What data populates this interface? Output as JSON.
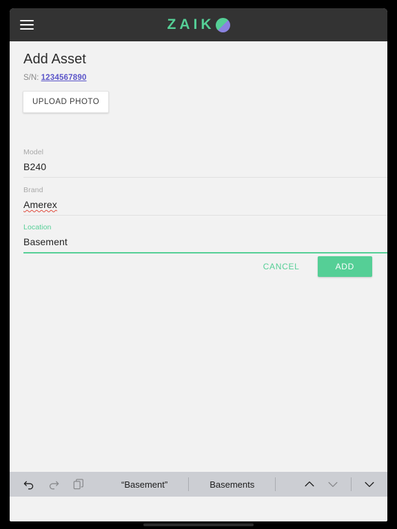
{
  "appbar": {
    "menu_icon": "hamburger-menu-icon",
    "logo_text": "ZAIK",
    "logo_mark": "half-circle-logo-mark",
    "background_color": "#333333"
  },
  "page": {
    "title": "Add Asset",
    "serial_label": "S/N:",
    "serial_number": "1234567890",
    "upload_photo_label": "UPLOAD PHOTO",
    "background_color": "#f2f2f2"
  },
  "form": {
    "fields": [
      {
        "label": "Model",
        "value": "B240",
        "focused": false,
        "misspelled": false
      },
      {
        "label": "Brand",
        "value": "Amerex",
        "focused": false,
        "misspelled": true
      },
      {
        "label": "Location",
        "value": "Basement",
        "focused": true,
        "misspelled": false
      }
    ],
    "cancel_label": "CANCEL",
    "add_label": "ADD",
    "accent_color": "#55cf96",
    "link_color": "#5b55c9"
  },
  "toolbar": {
    "undo_icon": "undo-arrow-icon",
    "redo_icon": "redo-arrow-icon",
    "paste_icon": "paste-clipboard-icon",
    "suggestions": [
      "“Basement”",
      "Basements"
    ],
    "prev_icon": "chevron-up-icon",
    "next_icon": "chevron-down-icon",
    "dismiss_icon": "chevron-down-dismiss-icon",
    "background_color": "#ccced3"
  }
}
